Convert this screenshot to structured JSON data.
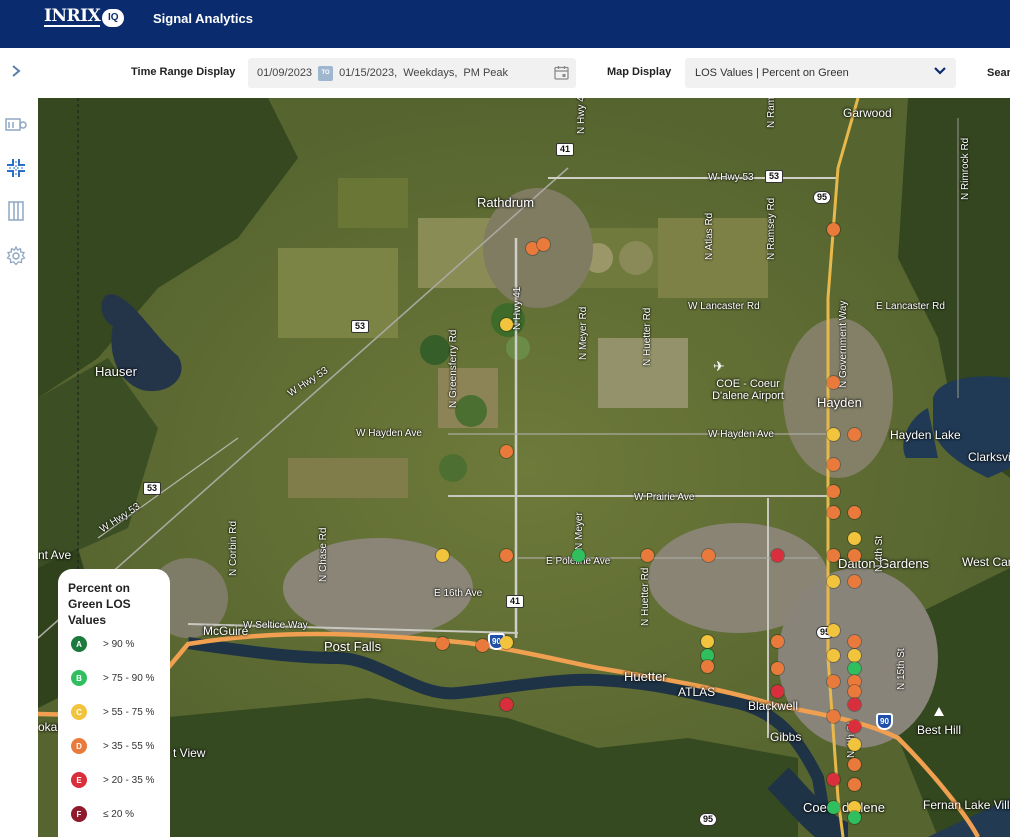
{
  "header": {
    "logo_text": "INRIX",
    "logo_badge": "IQ",
    "app_title": "Signal Analytics"
  },
  "sidebar": {
    "expand_icon": "chevron-right-icon",
    "items": [
      {
        "icon": "corridor-icon"
      },
      {
        "icon": "intersection-icon"
      },
      {
        "icon": "signal-list-icon"
      },
      {
        "icon": "gear-icon"
      }
    ]
  },
  "toolbar": {
    "time_range_label": "Time Range Display",
    "start_date": "01/09/2023",
    "to_badge": "TO",
    "end_date": "01/15/2023",
    "days": "Weekdays",
    "period": "PM Peak",
    "map_display_label": "Map Display",
    "map_display_value": "LOS Values | Percent on Green",
    "search_label": "Sear"
  },
  "colors": {
    "A": "#1c7a3c",
    "B": "#2fbf5e",
    "C": "#f2c43d",
    "D": "#ea7a3c",
    "E": "#d92e3b",
    "F": "#8e1a2c",
    "header": "#0a2c6e",
    "highway": "#f0a050"
  },
  "legend": {
    "title": "Percent on Green LOS Values",
    "items": [
      {
        "grade": "A",
        "range": "> 90 %"
      },
      {
        "grade": "B",
        "range": "> 75 - 90 %"
      },
      {
        "grade": "C",
        "range": "> 55 - 75 %"
      },
      {
        "grade": "D",
        "range": "> 35 - 55 %"
      },
      {
        "grade": "E",
        "range": "> 20 - 35 %"
      },
      {
        "grade": "F",
        "range": "≤ 20 %"
      }
    ]
  },
  "map": {
    "places": {
      "rathdrum": "Rathdrum",
      "hauser": "Hauser",
      "post_falls": "Post Falls",
      "mcguire": "McGuire",
      "huetter": "Huetter",
      "hayden": "Hayden",
      "hayden_lake": "Hayden Lake",
      "dalton_gardens": "Dalton Gardens",
      "clarksville": "Clarksvi",
      "west_canyon": "West Can",
      "blackwell": "Blackwell",
      "gibbs": "Gibbs",
      "coeur_dalene": "Coeur d'Alene",
      "fernan_lake": "Fernan Lake Village",
      "best_hill": "Best Hill",
      "garwood": "Garwood",
      "airport": "COE - Coeur D'alene Airport",
      "atlas": "ATLAS",
      "justice_view": "t View",
      "spokane_edge": "okan",
      "ant_ave": "nt Ave"
    },
    "roads": {
      "w_hwy_53_north": "W Hwy 53",
      "w_hwy_53_diag_1": "W Hwy 53",
      "w_hwy_53_diag_2": "W Hwy 53",
      "w_lancaster": "W Lancaster Rd",
      "e_lancaster": "E Lancaster Rd",
      "w_hayden_west": "W Hayden Ave",
      "w_hayden_east": "W Hayden Ave",
      "w_prairie": "W Prairie Ave",
      "e_poleline": "E Poleline Ave",
      "e_16th": "E 16th Ave",
      "w_seltice": "W Seltice Way",
      "n_greensferry": "N Greensferry Rd",
      "n_hwy_41": "N Hwy 41",
      "n_meyer": "N Meyer Rd",
      "n_huetter": "N Huetter Rd",
      "n_atlas": "N Atlas Rd",
      "n_ramsey": "N Ramsey Rd",
      "n_government": "N Government Way",
      "n_rimrock": "N Rimrock Rd",
      "n_corbin": "N Corbin Rd",
      "n_chase": "N Chase Rd",
      "n_meyer_south": "N Meyer",
      "n_huetter_south": "N Huetter Rd",
      "n_4th_1": "N 4th St",
      "n_4th_2": "N 4th St",
      "n_15th": "N 15th St",
      "n_hwy_41_top": "N Hwy 41",
      "n_ramsey_top": "N Ramsey Rd"
    },
    "shields": {
      "s41a": "41",
      "s41b": "41",
      "s53a": "53",
      "s53b": "53",
      "s53c": "53",
      "s95a": "95",
      "s95b": "95",
      "s95c": "95",
      "i90a": "90",
      "i90b": "90"
    }
  },
  "signals": [
    {
      "lon": 0.5092,
      "lat": 0.796,
      "grade": "D"
    },
    {
      "lon": 0.5197,
      "lat": 0.8017,
      "grade": "D"
    },
    {
      "lon": 0.4818,
      "lat": 0.6937,
      "grade": "C"
    },
    {
      "lon": 0.4818,
      "lat": 0.5217,
      "grade": "D"
    },
    {
      "lon": 0.4818,
      "lat": 0.3807,
      "grade": "D"
    },
    {
      "lon": 0.4818,
      "lat": 0.2633,
      "grade": "C"
    },
    {
      "lon": 0.4818,
      "lat": 0.1787,
      "grade": "E"
    },
    {
      "lon": 0.4161,
      "lat": 0.3807,
      "grade": "C"
    },
    {
      "lon": 0.5562,
      "lat": 0.3807,
      "grade": "B"
    },
    {
      "lon": 0.6271,
      "lat": 0.3807,
      "grade": "D"
    },
    {
      "lon": 0.6898,
      "lat": 0.3807,
      "grade": "D"
    },
    {
      "lon": 0.7603,
      "lat": 0.3807,
      "grade": "E"
    },
    {
      "lon": 0.4161,
      "lat": 0.2616,
      "grade": "D"
    },
    {
      "lon": 0.4568,
      "lat": 0.2593,
      "grade": "D"
    },
    {
      "lon": 0.6885,
      "lat": 0.2642,
      "grade": "C"
    },
    {
      "lon": 0.6885,
      "lat": 0.2463,
      "grade": "B"
    },
    {
      "lon": 0.6885,
      "lat": 0.2307,
      "grade": "D"
    },
    {
      "lon": 0.7603,
      "lat": 0.2642,
      "grade": "D"
    },
    {
      "lon": 0.7603,
      "lat": 0.2281,
      "grade": "D"
    },
    {
      "lon": 0.7603,
      "lat": 0.1975,
      "grade": "E"
    },
    {
      "lon": 0.8184,
      "lat": 0.822,
      "grade": "D"
    },
    {
      "lon": 0.8184,
      "lat": 0.6153,
      "grade": "D"
    },
    {
      "lon": 0.8184,
      "lat": 0.5442,
      "grade": "C"
    },
    {
      "lon": 0.8184,
      "lat": 0.5037,
      "grade": "D"
    },
    {
      "lon": 0.8184,
      "lat": 0.4679,
      "grade": "D"
    },
    {
      "lon": 0.8184,
      "lat": 0.439,
      "grade": "D"
    },
    {
      "lon": 0.8184,
      "lat": 0.3807,
      "grade": "D"
    },
    {
      "lon": 0.8184,
      "lat": 0.3456,
      "grade": "C"
    },
    {
      "lon": 0.8184,
      "lat": 0.28,
      "grade": "C"
    },
    {
      "lon": 0.8184,
      "lat": 0.2463,
      "grade": "C"
    },
    {
      "lon": 0.8184,
      "lat": 0.2101,
      "grade": "D"
    },
    {
      "lon": 0.8184,
      "lat": 0.1626,
      "grade": "D"
    },
    {
      "lon": 0.8184,
      "lat": 0.0782,
      "grade": "E"
    },
    {
      "lon": 0.8184,
      "lat": 0.0401,
      "grade": "B"
    },
    {
      "lon": 0.8399,
      "lat": 0.5442,
      "grade": "D"
    },
    {
      "lon": 0.8399,
      "lat": 0.439,
      "grade": "D"
    },
    {
      "lon": 0.8399,
      "lat": 0.4041,
      "grade": "C"
    },
    {
      "lon": 0.8399,
      "lat": 0.3807,
      "grade": "D"
    },
    {
      "lon": 0.8399,
      "lat": 0.3456,
      "grade": "D"
    },
    {
      "lon": 0.8399,
      "lat": 0.2642,
      "grade": "D"
    },
    {
      "lon": 0.8399,
      "lat": 0.2463,
      "grade": "C"
    },
    {
      "lon": 0.8399,
      "lat": 0.2281,
      "grade": "B"
    },
    {
      "lon": 0.8399,
      "lat": 0.2101,
      "grade": "D"
    },
    {
      "lon": 0.8399,
      "lat": 0.1975,
      "grade": "D"
    },
    {
      "lon": 0.8399,
      "lat": 0.1787,
      "grade": "E"
    },
    {
      "lon": 0.8399,
      "lat": 0.1498,
      "grade": "E"
    },
    {
      "lon": 0.8399,
      "lat": 0.1248,
      "grade": "C"
    },
    {
      "lon": 0.8399,
      "lat": 0.0985,
      "grade": "D"
    },
    {
      "lon": 0.8399,
      "lat": 0.0713,
      "grade": "D"
    },
    {
      "lon": 0.8399,
      "lat": 0.0401,
      "grade": "C"
    },
    {
      "lon": 0.8399,
      "lat": 0.026,
      "grade": "B"
    }
  ]
}
